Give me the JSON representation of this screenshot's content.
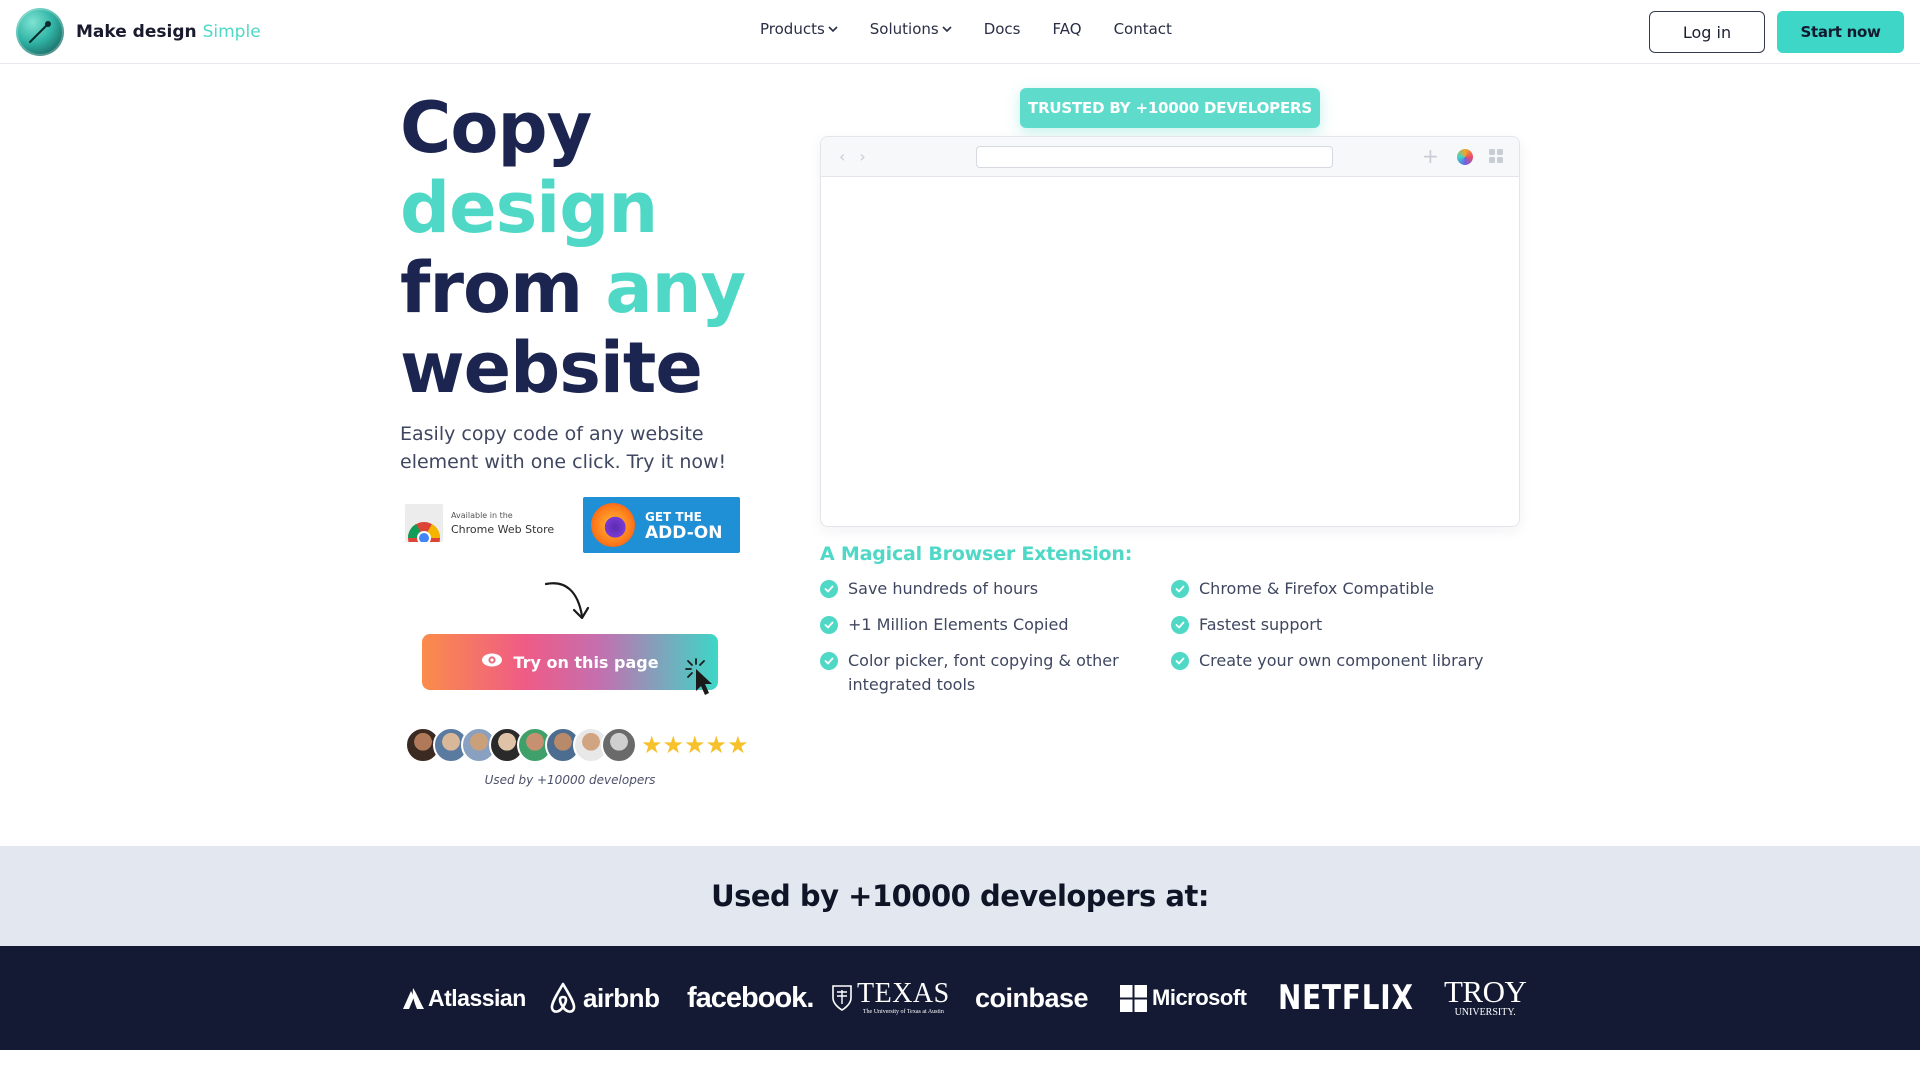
{
  "brand": {
    "name": "Make design",
    "accent": "Simple"
  },
  "nav": {
    "items": [
      {
        "label": "Products",
        "has_dropdown": true
      },
      {
        "label": "Solutions",
        "has_dropdown": true
      },
      {
        "label": "Docs",
        "has_dropdown": false
      },
      {
        "label": "FAQ",
        "has_dropdown": false
      },
      {
        "label": "Contact",
        "has_dropdown": false
      }
    ],
    "login_label": "Log in",
    "start_label": "Start now"
  },
  "hero": {
    "title_line1": "Copy",
    "title_line2": "design",
    "title_line3a": "from",
    "title_line3b": "any",
    "title_line4": "website",
    "subtitle": "Easily copy code of any website element with one click. Try it now!",
    "chrome_small": "Available in the",
    "chrome_big": "Chrome Web Store",
    "firefox_l1": "GET THE",
    "firefox_l2": "ADD-ON",
    "try_label": "Try on this page",
    "rating_stars": 5,
    "used_note": "Used by +10000 developers"
  },
  "right": {
    "trusted": "TRUSTED BY +10000 DEVELOPERS",
    "features_title": "A Magical Browser Extension:",
    "features": [
      "Save hundreds of hours",
      "Chrome & Firefox Compatible",
      "+1 Million Elements Copied",
      "Fastest support",
      "Color picker, font copying & other integrated tools",
      "Create your own component library"
    ]
  },
  "companies": {
    "heading": "Used by +10000 developers at:",
    "logos": [
      "Atlassian",
      "airbnb",
      "facebook.",
      "TEXAS",
      "The University of Texas at Austin",
      "coinbase",
      "Microsoft",
      "NETFLIX",
      "TROY",
      "UNIVERSITY."
    ]
  },
  "colors": {
    "accent": "#4fd8c6",
    "navy": "#1b2550",
    "band": "#e3e8f0",
    "dark": "#141a33"
  }
}
